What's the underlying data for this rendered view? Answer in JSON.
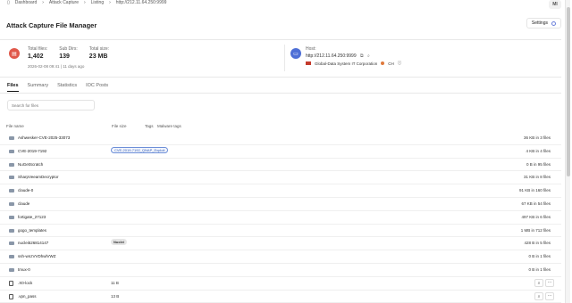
{
  "breadcrumbs": [
    "Dashboard",
    "Attack Capture",
    "Listing",
    "http://212.11.64.250:9999"
  ],
  "user": {
    "initials": "MI"
  },
  "page_title": "Attack Capture File Manager",
  "settings_label": "Settings",
  "stats": {
    "total_files_label": "Total files:",
    "total_files": "1,402",
    "sub_dirs_label": "Sub Dirs:",
    "sub_dirs": "139",
    "total_size_label": "Total size:",
    "total_size": "23 MB",
    "date": "2026-02-08 09:41 | 11 days ago"
  },
  "host": {
    "label": "Host:",
    "url": "http://212.11.64.250:9999",
    "org": "Global-Data System IT Corporation",
    "country": "CH"
  },
  "tabs": [
    "Files",
    "Summary",
    "Statistics",
    "IOC Posts"
  ],
  "search_placeholder": "Search for files",
  "columns": {
    "name": "File name",
    "size": "File size",
    "tags": "Tags",
    "malware": "Malware tags"
  },
  "rows": [
    {
      "type": "folder",
      "name": "Ashwesker-CVE-2025-33073",
      "meta": "36 KB in 3 files"
    },
    {
      "type": "folder",
      "name": "CVE-2019-7192",
      "tag": "CVE-2019-7192_QNAP_Exploit",
      "tag_style": "blue",
      "meta": "4 KB in 4 files"
    },
    {
      "type": "folder",
      "name": "NuGetScratch",
      "meta": "0 B in 95 files"
    },
    {
      "type": "folder",
      "name": "SharpVeeamDecryptor",
      "meta": "31 KB in 8 files"
    },
    {
      "type": "folder",
      "name": "claude-0",
      "meta": "91 KB in 160 files"
    },
    {
      "type": "folder",
      "name": "claude",
      "meta": "67 KB in 54 files"
    },
    {
      "type": "folder",
      "name": "fortigate_27123",
      "meta": "497 KB in 6 files"
    },
    {
      "type": "folder",
      "name": "gogo_templates",
      "meta": "1 MB in 712 files"
    },
    {
      "type": "folder",
      "name": "nuclei526814147",
      "tag": "Nuclei",
      "tag_style": "grey",
      "meta": "428 B in 5 files"
    },
    {
      "type": "folder",
      "name": "ssh-wnzVVDhwlVWZ",
      "meta": "0 B in 1 files"
    },
    {
      "type": "folder",
      "name": "tmux-0",
      "meta": "0 B in 1 files"
    },
    {
      "type": "file",
      "name": ".X0-lock",
      "size": "11 B"
    },
    {
      "type": "file",
      "name": ".vpn_pass",
      "size": "13 B"
    }
  ]
}
